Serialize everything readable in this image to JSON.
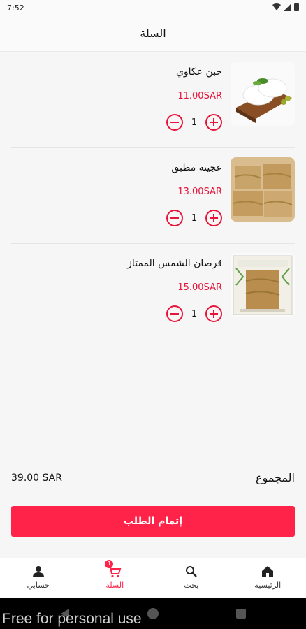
{
  "status": {
    "time": "7:52"
  },
  "header": {
    "title": "السلة"
  },
  "cart": {
    "items": [
      {
        "name": "جبن عكاوي",
        "price": "11.00SAR",
        "qty": "1",
        "image": "akkawi-cheese"
      },
      {
        "name": "عجينة مطبق",
        "price": "13.00SAR",
        "qty": "1",
        "image": "mutabbaq-dough"
      },
      {
        "name": "قرصان الشمس الممتاز",
        "price": "15.00SAR",
        "qty": "1",
        "image": "qursan-box"
      }
    ]
  },
  "summary": {
    "total_label": "المجموع",
    "total_value": "39.00 SAR"
  },
  "checkout": {
    "label": "إتمام الطلب"
  },
  "nav": {
    "items": [
      {
        "label": "حسابي",
        "icon": "person-icon"
      },
      {
        "label": "السلة",
        "icon": "cart-icon",
        "badge": "1",
        "active": true
      },
      {
        "label": "بحث",
        "icon": "search-icon"
      },
      {
        "label": "الرئيسية",
        "icon": "home-icon"
      }
    ]
  },
  "watermark": "Free for personal use",
  "colors": {
    "accent": "#ff234a",
    "price": "#e8143a"
  }
}
